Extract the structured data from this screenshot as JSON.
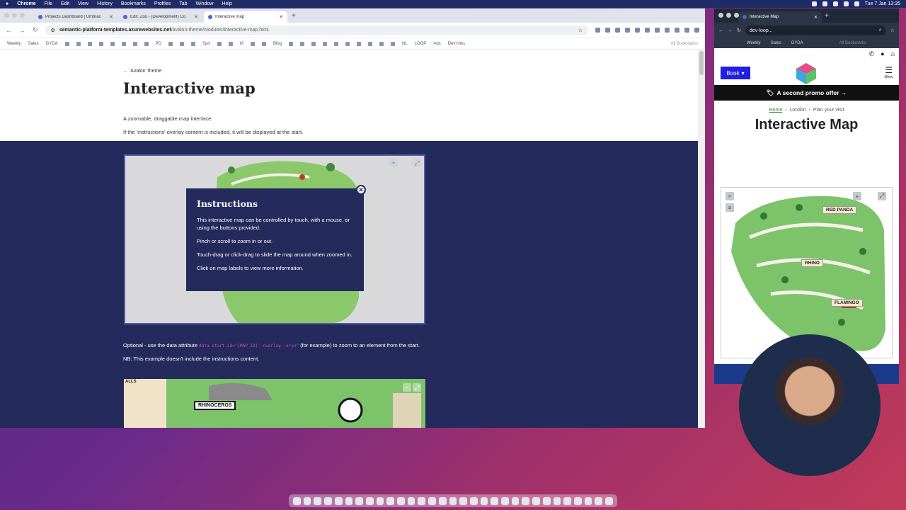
{
  "menubar": {
    "app": "Chrome",
    "items": [
      "File",
      "Edit",
      "View",
      "History",
      "Bookmarks",
      "Profiles",
      "Tab",
      "Window",
      "Help"
    ],
    "clock": "Tue 7 Jan  13:35"
  },
  "left_browser": {
    "tabs": [
      {
        "label": "Projects Dashboard | Umbrac"
      },
      {
        "label": "Edit: Zoo - (Development) Co"
      },
      {
        "label": "Interactive map"
      }
    ],
    "url_host": "semantic-platform-templates.azurewebsites.net",
    "url_path": "/avalon-theme/modules/interactive-map.html",
    "bookmarks": [
      "Weekly",
      "Sales",
      "GYDA",
      "PD",
      "Sprt",
      "M",
      "Blog",
      "NL",
      "LOOP",
      "Ads",
      "Dev links",
      "All Bookmarks"
    ]
  },
  "page": {
    "back_link": "'Avalon' theme",
    "title": "Interactive map",
    "desc1": "A zoomable, draggable map interface.",
    "desc2": "If the 'instructions' overlay content is included, it will be displayed at the start.",
    "instructions": {
      "title": "Instructions",
      "p1": "This interactive map can be controlled by touch, with a mouse, or using the buttons provided.",
      "p2": "Pinch or scroll to zoom in or out.",
      "p3": "Touch-drag or click-drag to slide the map around when zoomed in.",
      "p4": "Click on map labels to view more information."
    },
    "optional_pre": "Optional - use the data attribute",
    "optional_code": "data-start-id=\"[MAP ID]--overlay--oryx\"",
    "optional_post": "(for example) to zoom to an element from the start.",
    "nb": "NB: This example doesn't include the instructions content.",
    "map2_label": "RHINOCEROS",
    "map2_corner": "ALLS"
  },
  "right_browser": {
    "tab": "Interactive Map",
    "url": "dev-loop...",
    "bookmarks": [
      "Weekly",
      "Sales",
      "GYDA",
      "All Bookmarks"
    ],
    "book_button": "Book",
    "menu_label": "Menu",
    "promo": "A second promo offer →",
    "breadcrumb": [
      "Home",
      "London",
      "Plan your visit"
    ],
    "title": "Interactive Map",
    "map_labels": [
      "RED PANDA",
      "RHINO",
      "FLAMINGO"
    ]
  },
  "colors": {
    "navy": "#242a5c",
    "book_blue": "#1f1fe6",
    "map_green": "#7cc36a"
  }
}
